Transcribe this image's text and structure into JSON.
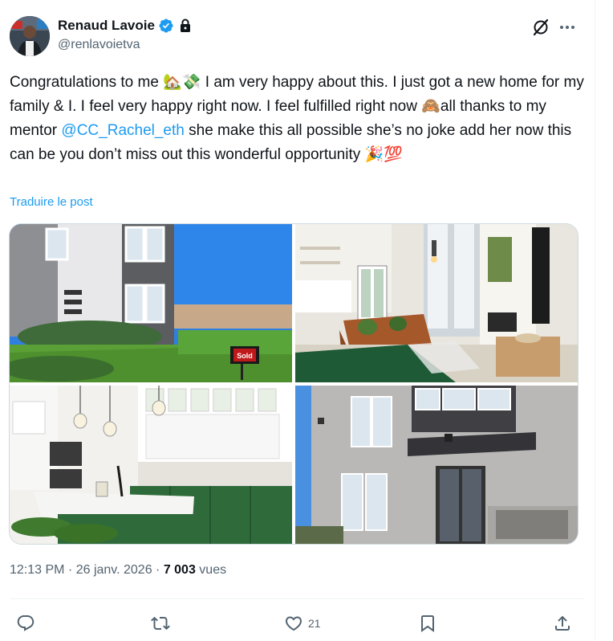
{
  "author": {
    "display_name": "Renaud Lavoie",
    "handle": "@renlavoietva",
    "verified_icon": "verified-badge-icon",
    "protected_icon": "lock-icon"
  },
  "tweet": {
    "text_part1": "Congratulations to me ",
    "text_part2": " I am very happy about this. I just got a new home for my family & I. I feel very happy right now. I feel fulfilled right now ",
    "text_part3": "all thanks to my mentor ",
    "mention": "@CC_Rachel_eth",
    "text_part4": " she make this all possible she’s no joke add her now  this can be you don’t miss out this wonderful opportunity ",
    "emoji_house": "🏡",
    "emoji_money": "💸",
    "emoji_monkey": "🙈",
    "emoji_party": "🎉",
    "emoji_hundred": "💯",
    "translate_label": "Traduire le post"
  },
  "media": {
    "sold_sign": "Sold"
  },
  "meta": {
    "time": "12:13 PM",
    "separator": " · ",
    "date": "26 janv. 2026",
    "views_count": "7 003",
    "views_label": " vues"
  },
  "actions": {
    "reply_icon": "reply-icon",
    "retweet_icon": "retweet-icon",
    "like_icon": "heart-icon",
    "like_count": "21",
    "bookmark_icon": "bookmark-icon",
    "share_icon": "share-icon"
  },
  "colors": {
    "accent": "#1d9bf0",
    "text": "#0f1419",
    "muted": "#536471",
    "border": "#cfd9de"
  }
}
